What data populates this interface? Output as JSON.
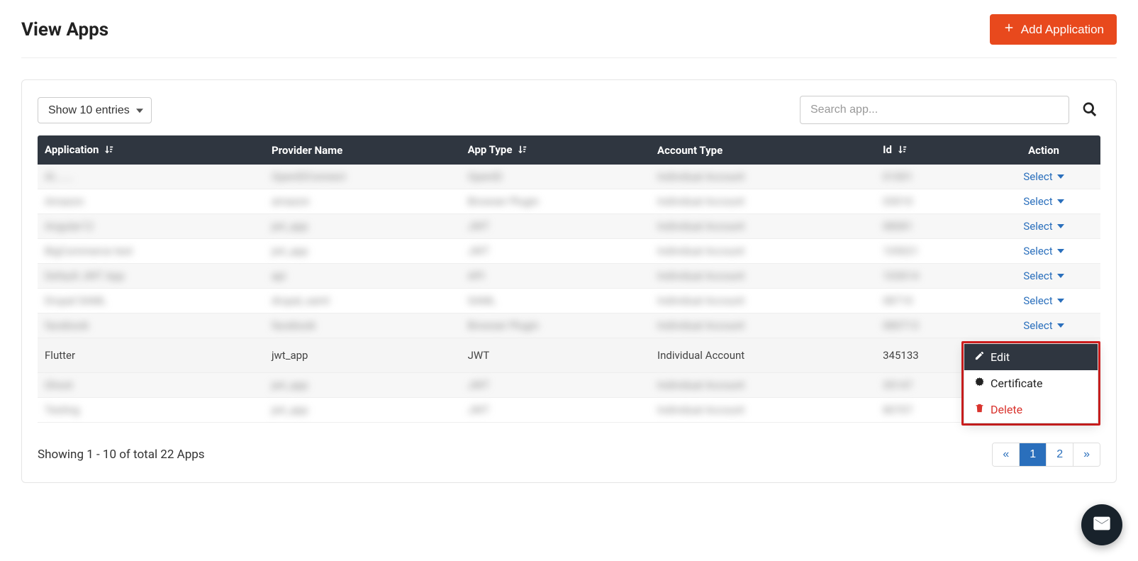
{
  "header": {
    "title": "View Apps",
    "add_button": "Add Application"
  },
  "toolbar": {
    "entries_label": "Show 10 entries",
    "search_placeholder": "Search app..."
  },
  "table": {
    "headers": {
      "application": "Application",
      "provider": "Provider Name",
      "apptype": "App Type",
      "accounttype": "Account Type",
      "id": "Id",
      "action": "Action"
    },
    "select_label": "Select",
    "blurred_rows": [
      {
        "app": "Al.......",
        "prov": "OpenIDConnect",
        "type": "OpenID",
        "acct": "Individual Account",
        "id": "01001"
      },
      {
        "app": "Amazon",
        "prov": "amazon",
        "type": "Browser Plugin",
        "acct": "Individual Account",
        "id": "03010"
      },
      {
        "app": "Angular12",
        "prov": "jwt_app",
        "type": "JWT",
        "acct": "Individual Account",
        "id": "08081"
      },
      {
        "app": "BigCommerce test",
        "prov": "jwt_app",
        "type": "JWT",
        "acct": "Individual Account",
        "id": "105021"
      },
      {
        "app": "Default JWT App",
        "prov": "api",
        "type": "API",
        "acct": "Individual Account",
        "id": "103014"
      },
      {
        "app": "Drupal SAML",
        "prov": "drupal_saml",
        "type": "SAML",
        "acct": "Individual Account",
        "id": "08710"
      },
      {
        "app": "facebook",
        "prov": "facebook",
        "type": "Browser Plugin",
        "acct": "Individual Account",
        "id": "080713"
      }
    ],
    "visible_row": {
      "app": "Flutter",
      "provider": "jwt_app",
      "apptype": "JWT",
      "accounttype": "Individual Account",
      "id": "345133"
    },
    "blurred_rows_after": [
      {
        "app": "Ghost",
        "prov": "jwt_app",
        "type": "JWT",
        "acct": "Individual Account",
        "id": "35147"
      },
      {
        "app": "Testing",
        "prov": "jwt_app",
        "type": "JWT",
        "acct": "Individual Account",
        "id": "80707"
      }
    ]
  },
  "dropdown": {
    "edit": "Edit",
    "certificate": "Certificate",
    "delete": "Delete"
  },
  "footer": {
    "showing": "Showing 1 - 10 of total 22 Apps",
    "pages": {
      "prev": "«",
      "p1": "1",
      "p2": "2",
      "next": "»"
    }
  }
}
